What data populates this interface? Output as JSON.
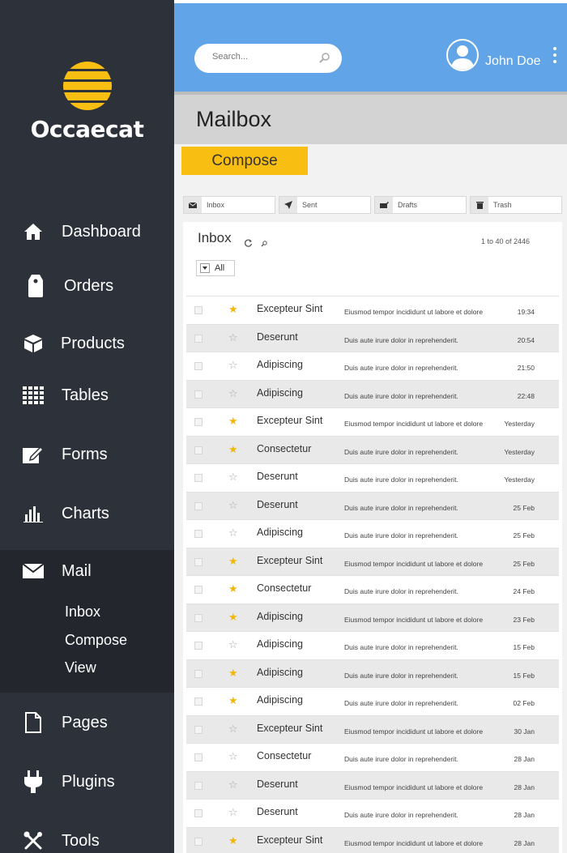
{
  "brand": {
    "name": "Occaecat"
  },
  "sidebar": {
    "items": [
      {
        "label": "Dashboard",
        "icon": "home-icon"
      },
      {
        "label": "Orders",
        "icon": "tag-icon"
      },
      {
        "label": "Products",
        "icon": "box-icon"
      },
      {
        "label": "Tables",
        "icon": "grid-icon"
      },
      {
        "label": "Forms",
        "icon": "edit-icon"
      },
      {
        "label": "Charts",
        "icon": "bar-chart-icon"
      },
      {
        "label": "Mail",
        "icon": "envelope-icon"
      },
      {
        "label": "Pages",
        "icon": "page-icon"
      },
      {
        "label": "Plugins",
        "icon": "plug-icon"
      },
      {
        "label": "Tools",
        "icon": "tools-icon"
      }
    ],
    "mail_submenu": [
      "Inbox",
      "Compose",
      "View"
    ]
  },
  "header": {
    "search_placeholder": "Search...",
    "user_name": "John Doe"
  },
  "page": {
    "title": "Mailbox",
    "compose_label": "Compose"
  },
  "folders": [
    {
      "label": "Inbox",
      "icon": "envelope-icon"
    },
    {
      "label": "Sent",
      "icon": "send-icon"
    },
    {
      "label": "Drafts",
      "icon": "drafts-icon"
    },
    {
      "label": "Trash",
      "icon": "trash-icon"
    }
  ],
  "inbox": {
    "title": "Inbox",
    "paging": "1 to 40 of 2446",
    "filter": "All",
    "rows": [
      {
        "sender": "Excepteur Sint",
        "subject": "Eiusmod tempor incididunt ut labore et dolore",
        "time": "19:34",
        "starred": true
      },
      {
        "sender": "Deserunt",
        "subject": "Duis aute irure dolor in reprehenderit.",
        "time": "20:54",
        "starred": false
      },
      {
        "sender": "Adipiscing",
        "subject": "Duis aute irure dolor in reprehenderit.",
        "time": "21:50",
        "starred": false
      },
      {
        "sender": "Adipiscing",
        "subject": "Duis aute irure dolor in reprehenderit.",
        "time": "22:48",
        "starred": false
      },
      {
        "sender": "Excepteur Sint",
        "subject": "Eiusmod tempor incididunt ut labore et dolore",
        "time": "Yesterday",
        "starred": true
      },
      {
        "sender": "Consectetur",
        "subject": "Duis aute irure dolor in reprehenderit.",
        "time": "Yesterday",
        "starred": true
      },
      {
        "sender": "Deserunt",
        "subject": "Duis aute irure dolor in reprehenderit.",
        "time": "Yesterday",
        "starred": false
      },
      {
        "sender": "Deserunt",
        "subject": "Duis aute irure dolor in reprehenderit.",
        "time": "25 Feb",
        "starred": false
      },
      {
        "sender": "Adipiscing",
        "subject": "Duis aute irure dolor in reprehenderit.",
        "time": "25 Feb",
        "starred": false
      },
      {
        "sender": "Excepteur Sint",
        "subject": "Eiusmod tempor incididunt ut labore et dolore",
        "time": "25 Feb",
        "starred": true
      },
      {
        "sender": "Consectetur",
        "subject": "Duis aute irure dolor in reprehenderit.",
        "time": "24 Feb",
        "starred": true
      },
      {
        "sender": "Adipiscing",
        "subject": "Eiusmod tempor incididunt ut labore et dolore",
        "time": "23 Feb",
        "starred": true
      },
      {
        "sender": "Adipiscing",
        "subject": "Duis aute irure dolor in reprehenderit.",
        "time": "15 Feb",
        "starred": false
      },
      {
        "sender": "Adipiscing",
        "subject": "Duis aute irure dolor in reprehenderit.",
        "time": "15 Feb",
        "starred": true
      },
      {
        "sender": "Adipiscing",
        "subject": "Duis aute irure dolor in reprehenderit.",
        "time": "02 Feb",
        "starred": true
      },
      {
        "sender": "Excepteur Sint",
        "subject": "Eiusmod tempor incididunt ut labore et dolore",
        "time": "30 Jan",
        "starred": false
      },
      {
        "sender": "Consectetur",
        "subject": "Duis aute irure dolor in reprehenderit.",
        "time": "28 Jan",
        "starred": false
      },
      {
        "sender": "Deserunt",
        "subject": "Eiusmod tempor incididunt ut labore et dolore",
        "time": "28 Jan",
        "starred": false
      },
      {
        "sender": "Deserunt",
        "subject": "Duis aute irure dolor in reprehenderit.",
        "time": "28 Jan",
        "starred": false
      },
      {
        "sender": "Excepteur Sint",
        "subject": "Eiusmod tempor incididunt ut labore et dolore",
        "time": "28 Jan",
        "starred": true
      }
    ]
  },
  "colors": {
    "sidebar": "#2d313a",
    "header": "#61a5e8",
    "accent": "#f9be12",
    "star": "#f2b705"
  }
}
